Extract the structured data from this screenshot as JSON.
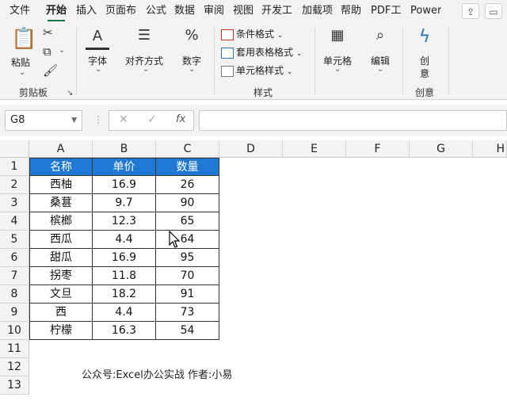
{
  "ribbon_tabs": [
    "文件",
    "开始",
    "插入",
    "页面布",
    "公式",
    "数据",
    "审阅",
    "视图",
    "开发工",
    "加载项",
    "帮助",
    "PDF工",
    "Power"
  ],
  "active_tab": "开始",
  "clipboard": {
    "paste": "粘贴",
    "group": "剪贴板"
  },
  "font_label": "字体",
  "align_label": "对齐方式",
  "number_label": "数字",
  "styles": {
    "conditional": "条件格式",
    "table": "套用表格格式",
    "cell_style": "单元格样式",
    "group": "样式"
  },
  "cells_label": "单元格",
  "edit_label": "编辑",
  "create": {
    "line1": "创",
    "line2": "意",
    "group": "创意"
  },
  "formula_bar": {
    "name_box": "G8",
    "fx": "fx"
  },
  "columns": [
    "A",
    "B",
    "C",
    "D",
    "E",
    "F",
    "G",
    "H"
  ],
  "rows": [
    "1",
    "2",
    "3",
    "4",
    "5",
    "6",
    "7",
    "8",
    "9",
    "10",
    "11",
    "12",
    "13"
  ],
  "table": {
    "headers": [
      "名称",
      "单价",
      "数量"
    ],
    "rows": [
      [
        "西柚",
        "16.9",
        "26"
      ],
      [
        "桑葚",
        "9.7",
        "90"
      ],
      [
        "槟榔",
        "12.3",
        "65"
      ],
      [
        "西瓜",
        "4.4",
        "64"
      ],
      [
        "甜瓜",
        "16.9",
        "95"
      ],
      [
        "拐枣",
        "11.8",
        "70"
      ],
      [
        "文旦",
        "18.2",
        "91"
      ],
      [
        "西",
        "4.4",
        "73"
      ],
      [
        "柠檬",
        "16.3",
        "54"
      ]
    ]
  },
  "footer_note": "公众号:Excel办公实战  作者:小易",
  "colors": {
    "header_fill": "#1f78d1",
    "accent": "#107c41"
  }
}
